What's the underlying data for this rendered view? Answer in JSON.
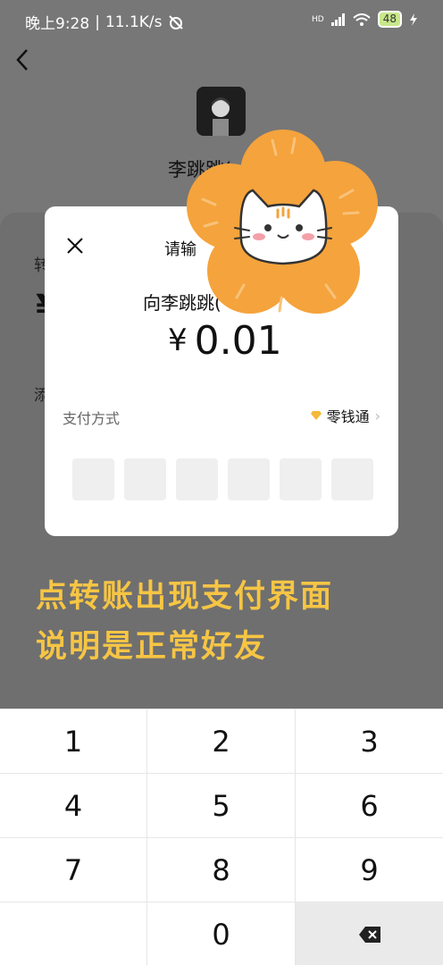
{
  "status_bar": {
    "time": "晚上9:28",
    "speed": "11.1K/s",
    "signal": "HD",
    "battery": "48"
  },
  "header": {
    "recipient_name": "李跳跳("
  },
  "background_sheet": {
    "label": "转",
    "currency": "¥",
    "note": "添"
  },
  "dialog": {
    "title": "请输",
    "pay_to": "向李跳跳(",
    "amount": "0.01",
    "currency_symbol": "¥",
    "payment_method_label": "支付方式",
    "payment_method_value": "零钱通",
    "pin_length": 6
  },
  "caption": {
    "line1": "点转账出现支付界面",
    "line2": "说明是正常好友"
  },
  "keypad": {
    "keys": [
      "1",
      "2",
      "3",
      "4",
      "5",
      "6",
      "7",
      "8",
      "9",
      "",
      "0"
    ]
  },
  "colors": {
    "caption": "#f6c544",
    "sticker": "#f5a33c",
    "overlay": "#777777"
  }
}
